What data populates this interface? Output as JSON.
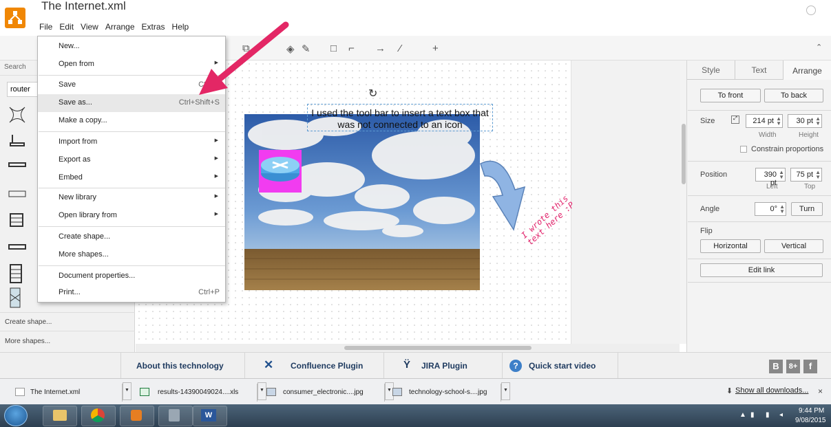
{
  "app": {
    "title": "The Internet.xml",
    "menus": [
      "File",
      "Edit",
      "View",
      "Arrange",
      "Extras",
      "Help"
    ]
  },
  "file_menu": {
    "items": [
      {
        "label": "New...",
        "shortcut": "",
        "submenu": false
      },
      {
        "label": "Open from",
        "shortcut": "",
        "submenu": true
      },
      {
        "label": "Save",
        "shortcut": "Ctrl+S",
        "submenu": false
      },
      {
        "label": "Save as...",
        "shortcut": "Ctrl+Shift+S",
        "submenu": false
      },
      {
        "label": "Make a copy...",
        "shortcut": "",
        "submenu": false
      },
      {
        "label": "Import from",
        "shortcut": "",
        "submenu": true
      },
      {
        "label": "Export as",
        "shortcut": "",
        "submenu": true
      },
      {
        "label": "Embed",
        "shortcut": "",
        "submenu": true
      },
      {
        "label": "New library",
        "shortcut": "",
        "submenu": true
      },
      {
        "label": "Open library from",
        "shortcut": "",
        "submenu": true
      },
      {
        "label": "Create shape...",
        "shortcut": "",
        "submenu": false
      },
      {
        "label": "More shapes...",
        "shortcut": "",
        "submenu": false
      },
      {
        "label": "Document properties...",
        "shortcut": "",
        "submenu": false
      },
      {
        "label": "Print...",
        "shortcut": "Ctrl+P",
        "submenu": false
      }
    ],
    "highlighted": "Save as..."
  },
  "sidebar": {
    "search_header": "Search",
    "search_value": "router",
    "create_shape": "Create shape...",
    "more_shapes": "More shapes..."
  },
  "canvas": {
    "textbox_text": "I used the tool bar to insert a text box that was not connected to an icon",
    "handwritten_text": "I wrote this text here :P"
  },
  "right_panel": {
    "tabs": [
      "Style",
      "Text",
      "Arrange"
    ],
    "active_tab": "Arrange",
    "to_front": "To front",
    "to_back": "To back",
    "size_label": "Size",
    "width_value": "214 pt",
    "height_value": "30 pt",
    "width_label": "Width",
    "height_label": "Height",
    "constrain": "Constrain proportions",
    "position_label": "Position",
    "left_value": "390 pt",
    "top_value": "75 pt",
    "left_label": "Left",
    "top_label": "Top",
    "angle_label": "Angle",
    "angle_value": "0°",
    "turn": "Turn",
    "flip_label": "Flip",
    "horizontal": "Horizontal",
    "vertical": "Vertical",
    "edit_link": "Edit link"
  },
  "footer": {
    "about": "About this technology",
    "confluence": "Confluence Plugin",
    "jira": "JIRA Plugin",
    "quickstart": "Quick start video"
  },
  "downloads": {
    "items": [
      "The Internet.xml",
      "results-14390049024....xls",
      "consumer_electronic....jpg",
      "technology-school-s....jpg"
    ],
    "show_all": "Show all downloads...",
    "close": "×"
  },
  "taskbar": {
    "time": "9:44 PM",
    "date": "9/08/2015"
  },
  "colors": {
    "accent_orange": "#f08705",
    "router_pink": "#f13cf0",
    "annotation_arrow": "#e32765",
    "handwriting": "#e2246c"
  }
}
